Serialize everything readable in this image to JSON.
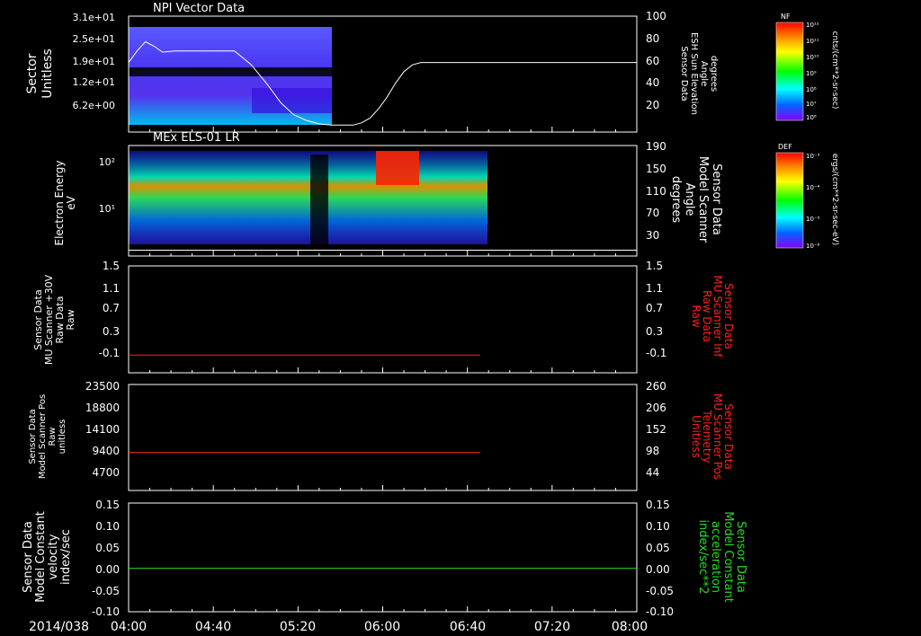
{
  "footer": {
    "date": "2014/038"
  },
  "time_axis": {
    "ticks": [
      "04:00",
      "04:40",
      "05:20",
      "06:00",
      "06:40",
      "07:20",
      "08:00"
    ],
    "minutes": [
      0,
      40,
      80,
      120,
      160,
      200,
      240
    ]
  },
  "colorbars": [
    {
      "label": "NF",
      "units": "cnts/(cm**2-sr-sec)",
      "ticks": [
        "10¹²",
        "10¹¹",
        "10¹⁰",
        "10⁹",
        "10⁸",
        "10⁷",
        "10⁶"
      ]
    },
    {
      "label": "DEF",
      "units": "ergs/(cm**2-sr-sec-eV)",
      "ticks": [
        "10⁻³",
        "10⁻⁴",
        "10⁻⁵",
        "10⁻⁶"
      ]
    }
  ],
  "colors": {
    "red_trace": "#ff2020",
    "green_trace": "#22dd22",
    "white": "#ffffff"
  },
  "chart_data": [
    {
      "type": "heatmap",
      "title": "NPI Vector Data",
      "ylabel": [
        "Sector",
        "Unitless"
      ],
      "yticks": [
        "3.1e+01",
        "2.5e+01",
        "1.9e+01",
        "1.2e+01",
        "6.2e+00"
      ],
      "right_ylabel": [
        "Sensor Data",
        "ESH Sun Elevation",
        "Angle",
        "degrees"
      ],
      "right_yticks": [
        "100",
        "80",
        "60",
        "40",
        "20"
      ],
      "right_ylim": [
        0,
        100
      ],
      "data_extent_minutes": [
        0,
        82
      ],
      "line": {
        "name": "ESH Sun Elevation Angle",
        "x_minutes": [
          0,
          4,
          8,
          12,
          16,
          22,
          30,
          40,
          50,
          58,
          66,
          72,
          78,
          84,
          90,
          96,
          100,
          106,
          110,
          114,
          118,
          122,
          126,
          130,
          134,
          138,
          142,
          150,
          160,
          180,
          200,
          220,
          240
        ],
        "y": [
          60,
          70,
          78,
          74,
          69,
          70,
          70,
          70,
          70,
          58,
          40,
          25,
          15,
          10,
          7,
          6,
          6,
          6,
          8,
          12,
          20,
          30,
          42,
          52,
          58,
          60,
          60,
          60,
          60,
          60,
          60,
          60,
          60
        ]
      }
    },
    {
      "type": "heatmap",
      "title": "MEx ELS-01 LR",
      "ylabel": [
        "Electron Energy",
        "eV"
      ],
      "yticks": [
        "10²",
        "10¹"
      ],
      "right_ylabel": [
        "Sensor Data",
        "Model Scanner",
        "Angle",
        "degrees"
      ],
      "right_yticks": [
        "190",
        "150",
        "110",
        "70",
        "30"
      ],
      "right_ylim": [
        0,
        190
      ],
      "data_extent_minutes": [
        0,
        162
      ],
      "line": {
        "name": "Model Scanner Angle",
        "x_minutes": [
          0,
          240
        ],
        "y": [
          10,
          10
        ]
      }
    },
    {
      "type": "line",
      "ylabel": [
        "Sensor Data",
        "MU Scanner +30V",
        "Raw Data",
        "Raw"
      ],
      "yticks": [
        "1.5",
        "1.1",
        "0.7",
        "0.3",
        "-0.1"
      ],
      "ylim": [
        -0.3,
        1.5
      ],
      "right_ylabel": [
        "Sensor Data",
        "MU Scanner Inf",
        "Raw Data",
        "Raw"
      ],
      "right_yticks": [
        "1.5",
        "1.1",
        "0.7",
        "0.3",
        "-0.1"
      ],
      "series": [
        {
          "x_minutes": [
            0,
            166
          ],
          "y": [
            0.0,
            0.0
          ]
        }
      ]
    },
    {
      "type": "line",
      "ylabel": [
        "Sensor Data",
        "Model Scanner Pos",
        "Raw",
        "unitless"
      ],
      "yticks": [
        "23500",
        "18800",
        "14100",
        "9400",
        "4700"
      ],
      "ylim": [
        0,
        23500
      ],
      "right_ylabel": [
        "Sensor Data",
        "MU Scanner Pos",
        "Telemetry",
        "Unitless"
      ],
      "right_yticks": [
        "260",
        "206",
        "152",
        "98",
        "44"
      ],
      "series": [
        {
          "x_minutes": [
            0,
            166
          ],
          "y": [
            8450,
            8450
          ]
        }
      ]
    },
    {
      "type": "line",
      "ylabel": [
        "Sensor Data",
        "Model Constant",
        "velocity",
        "index/sec"
      ],
      "yticks": [
        "0.15",
        "0.10",
        "0.05",
        "0.00",
        "-0.05",
        "-0.10"
      ],
      "ylim": [
        -0.1,
        0.15
      ],
      "right_ylabel": [
        "Sensor Data",
        "Model Constant",
        "acceleration",
        "index/sec**2"
      ],
      "right_yticks": [
        "0.15",
        "0.10",
        "0.05",
        "0.00",
        "-0.05",
        "-0.10"
      ],
      "series": [
        {
          "x_minutes": [
            0,
            240
          ],
          "y": [
            0.0,
            0.0
          ]
        }
      ]
    }
  ]
}
